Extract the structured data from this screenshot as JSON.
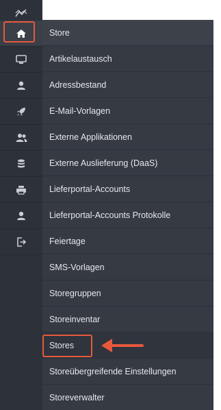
{
  "sidebar": {
    "icons": [
      {
        "name": "chart-line-icon"
      },
      {
        "name": "home-icon"
      },
      {
        "name": "monitor-icon"
      },
      {
        "name": "user-icon"
      },
      {
        "name": "rocket-icon"
      },
      {
        "name": "users-icon"
      },
      {
        "name": "database-icon"
      },
      {
        "name": "printer-icon"
      },
      {
        "name": "user-icon"
      },
      {
        "name": "sign-out-icon"
      }
    ],
    "active_icon": "home-icon"
  },
  "menu": {
    "items": [
      {
        "label": "Store"
      },
      {
        "label": "Artikelaustausch"
      },
      {
        "label": "Adressbestand"
      },
      {
        "label": "E-Mail-Vorlagen"
      },
      {
        "label": "Externe Applikationen"
      },
      {
        "label": "Externe Auslieferung (DaaS)"
      },
      {
        "label": "Lieferportal-Accounts"
      },
      {
        "label": "Lieferportal-Accounts Protokolle"
      },
      {
        "label": "Feiertage"
      },
      {
        "label": "SMS-Vorlagen"
      },
      {
        "label": "Storegruppen"
      },
      {
        "label": "Storeinventar"
      },
      {
        "label": "Stores"
      },
      {
        "label": "Storeübergreifende Einstellungen"
      },
      {
        "label": "Storeverwalter"
      }
    ],
    "selected": "Stores"
  },
  "colors": {
    "sidebar_bg": "#2d3139",
    "menu_bg": "#353a43",
    "text": "#e6e8eb",
    "icon": "#c9ccd1",
    "highlight": "#e8593c"
  }
}
